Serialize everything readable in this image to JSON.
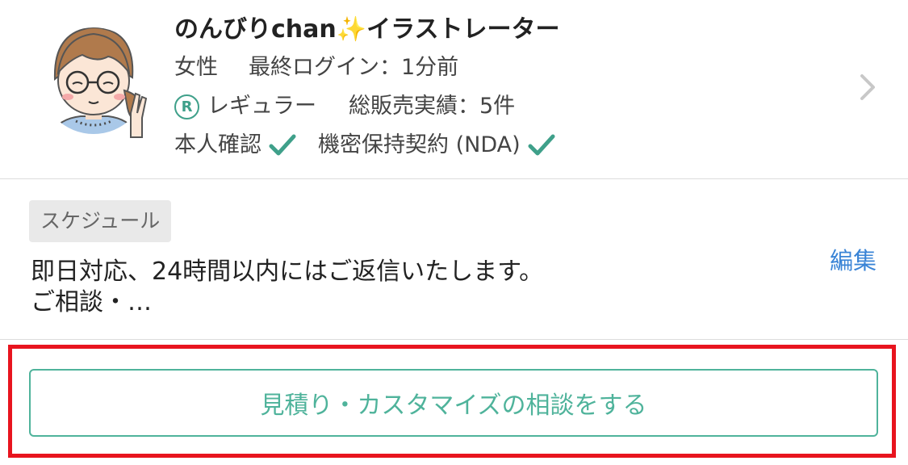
{
  "profile": {
    "name": "のんびりchan",
    "name_sparkle": "✨",
    "title": "イラストレーター",
    "gender": "女性",
    "last_login": "最終ログイン：1分前",
    "rank_icon_letter": "R",
    "rank": "レギュラー",
    "total_sales": "総販売実績：5件",
    "identity_verified": "本人確認",
    "nda": "機密保持契約 (NDA)",
    "accent_color": "#3fa08a"
  },
  "schedule": {
    "tag": "スケジュール",
    "text": "即日対応、24時間以内にはご返信いたします。\nご相談・…",
    "edit_label": "編集"
  },
  "cta": {
    "label": "見積り・カスタマイズの相談をする",
    "color": "#4fb39b",
    "highlight_color": "#e8141e"
  },
  "icons": {
    "avatar": "avatar-illustration",
    "check": "check-icon",
    "chevron": "chevron-right-icon",
    "rank": "regular-rank-icon"
  }
}
